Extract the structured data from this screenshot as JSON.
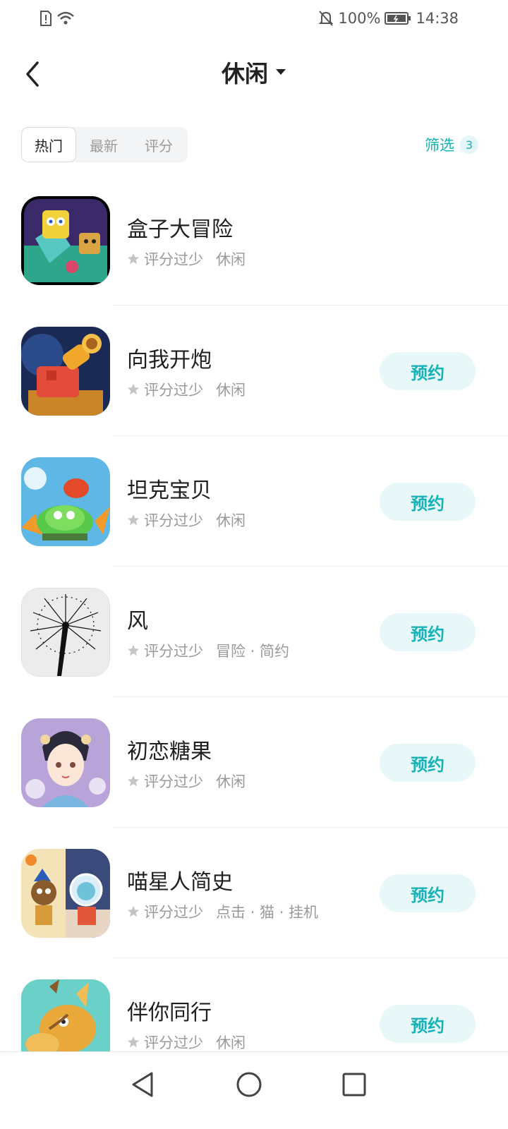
{
  "status_bar": {
    "battery": "100%",
    "time": "14:38"
  },
  "header": {
    "title": "休闲"
  },
  "sort_tabs": [
    {
      "label": "热门",
      "active": true
    },
    {
      "label": "最新",
      "active": false
    },
    {
      "label": "评分",
      "active": false
    }
  ],
  "filter": {
    "label": "筛选",
    "count": "3"
  },
  "games": [
    {
      "name": "盒子大冒险",
      "rating": "评分过少",
      "tags": "休闲",
      "action": ""
    },
    {
      "name": "向我开炮",
      "rating": "评分过少",
      "tags": "休闲",
      "action": "预约"
    },
    {
      "name": "坦克宝贝",
      "rating": "评分过少",
      "tags": "休闲",
      "action": "预约"
    },
    {
      "name": "风",
      "rating": "评分过少",
      "tags": "冒险 · 简约",
      "action": "预约"
    },
    {
      "name": "初恋糖果",
      "rating": "评分过少",
      "tags": "休闲",
      "action": "预约"
    },
    {
      "name": "喵星人简史",
      "rating": "评分过少",
      "tags": "点击 · 猫 · 挂机",
      "action": "预约"
    },
    {
      "name": "伴你同行",
      "rating": "评分过少",
      "tags": "休闲",
      "action": "预约"
    }
  ],
  "colors": {
    "accent": "#15b3b8",
    "accent_bg": "#e8f7f8"
  }
}
